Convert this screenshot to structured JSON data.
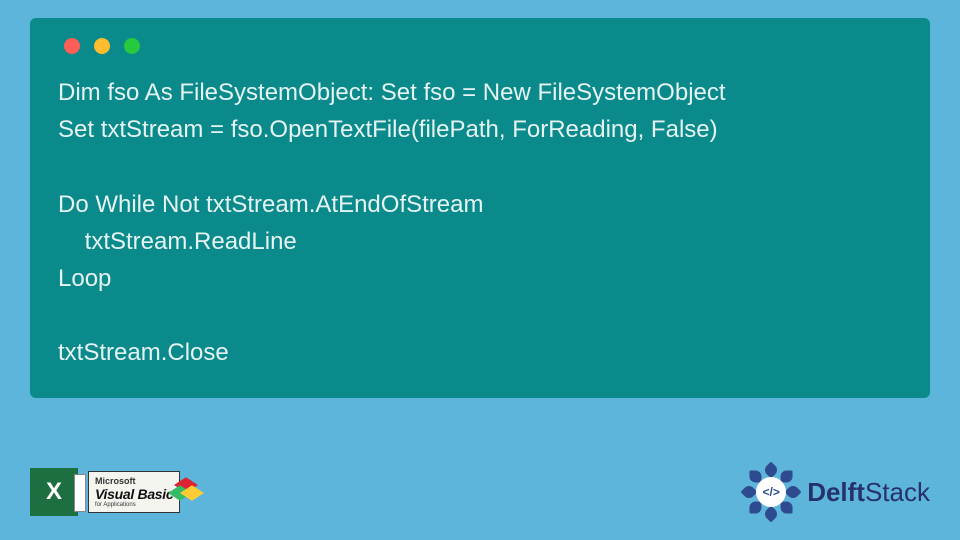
{
  "code": {
    "line1": "Dim fso As FileSystemObject: Set fso = New FileSystemObject",
    "line2": "Set txtStream = fso.OpenTextFile(filePath, ForReading, False)",
    "line3": "",
    "line4": "Do While Not txtStream.AtEndOfStream",
    "line5": "    txtStream.ReadLine",
    "line6": "Loop",
    "line7": "",
    "line8": "txtStream.Close"
  },
  "logos": {
    "excel_letter": "X",
    "vb_brand_top": "Microsoft",
    "vb_brand_main": "Visual Basic",
    "vb_brand_sub": "for Applications",
    "delft_center": "</>",
    "delft_text_bold": "Delft",
    "delft_text_rest": "Stack"
  },
  "colors": {
    "page_bg": "#5eb5db",
    "code_bg": "#0a8a8a",
    "code_fg": "#e6f3f3",
    "excel": "#1d6f42",
    "delft": "#2d4b8e"
  }
}
